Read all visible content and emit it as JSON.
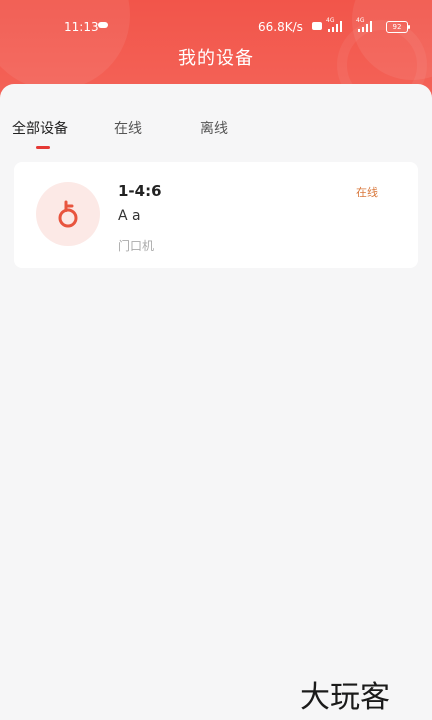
{
  "status_bar": {
    "time": "11:13",
    "speed": "66.8K/s",
    "network_1": "4G",
    "network_2": "4G",
    "battery": "92"
  },
  "header": {
    "title": "我的设备"
  },
  "tabs": [
    {
      "label": "全部设备",
      "active": true
    },
    {
      "label": "在线",
      "active": false
    },
    {
      "label": "离线",
      "active": false
    }
  ],
  "devices": [
    {
      "name": "1-4:6",
      "subtitle": "A a",
      "type": "门口机",
      "status": "在线",
      "icon": "key-icon"
    }
  ],
  "watermark": "大玩客",
  "colors": {
    "header": "#f2554a",
    "accent": "#e53935",
    "status_online": "#d9783c",
    "avatar_bg": "#fce9e6"
  }
}
